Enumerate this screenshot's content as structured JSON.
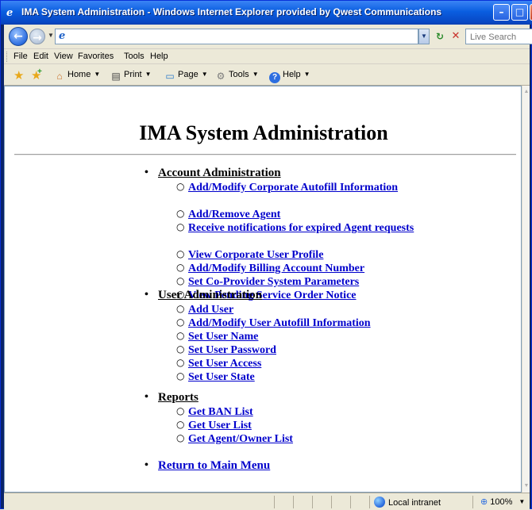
{
  "window": {
    "title": "IMA System Administration - Windows Internet Explorer provided by Qwest Communications",
    "min_glyph": "–",
    "max_glyph": "□",
    "close_glyph": "✕"
  },
  "navbar": {
    "address_value": "",
    "search_placeholder": "Live Search"
  },
  "menubar": {
    "items": [
      "File",
      "Edit",
      "View",
      "Favorites",
      "Tools",
      "Help"
    ]
  },
  "commandbar": {
    "home": "Home",
    "print": "Print",
    "page": "Page",
    "tools": "Tools",
    "help": "Help"
  },
  "page": {
    "heading": "IMA System Administration",
    "sections": [
      {
        "title": "Account Administration",
        "items": [
          "Add/Modify Corporate Autofill Information",
          "Add/Remove Agent",
          "Receive notifications for expired Agent requests",
          "View Corporate User Profile",
          "Add/Modify Billing Account Number",
          "Set Co-Provider System Parameters",
          "View Pending Service Order Notice"
        ]
      },
      {
        "title": "User Administration",
        "items": [
          "Add User",
          "Add/Modify User Autofill Information",
          "Set User Name",
          "Set User Password",
          "Set User Access",
          "Set User State"
        ]
      },
      {
        "title": "Reports",
        "items": [
          "Get BAN List",
          "Get User List",
          "Get Agent/Owner List"
        ]
      }
    ],
    "return_link": "Return to Main Menu"
  },
  "statusbar": {
    "zone": "Local intranet",
    "zoom": "100%"
  },
  "colors": {
    "link": "#0000cc",
    "titlebar": "#0a5ee0",
    "chrome": "#ece9d8"
  }
}
